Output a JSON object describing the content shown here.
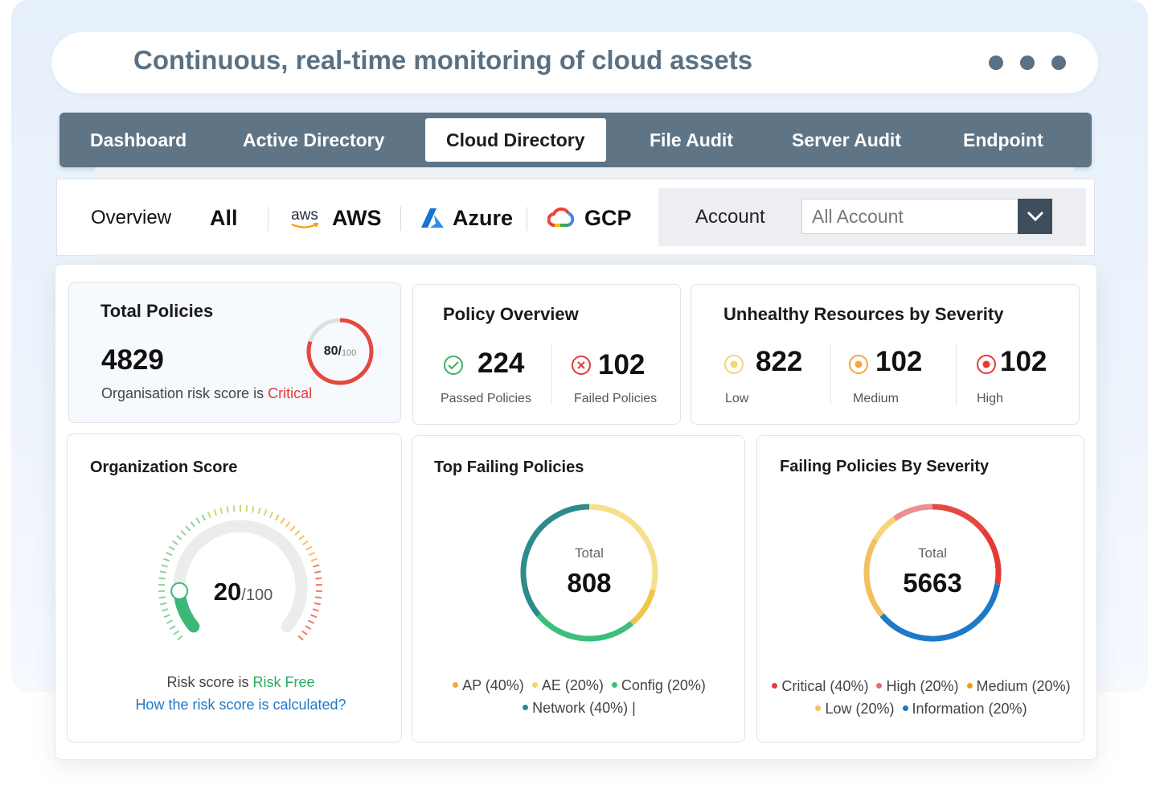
{
  "header": {
    "title": "Continuous, real-time monitoring of cloud assets"
  },
  "nav": {
    "items": [
      {
        "label": "Dashboard",
        "active": false
      },
      {
        "label": "Active Directory",
        "active": false
      },
      {
        "label": "Cloud Directory",
        "active": true
      },
      {
        "label": "File Audit",
        "active": false
      },
      {
        "label": "Server Audit",
        "active": false
      },
      {
        "label": "Endpoint",
        "active": false
      }
    ]
  },
  "subnav": {
    "overview": "Overview",
    "all": "All",
    "aws": "AWS",
    "aws_logo": "aws",
    "azure": "Azure",
    "gcp": "GCP",
    "account_label": "Account",
    "account_value": "All Account"
  },
  "total_policies": {
    "title": "Total Policies",
    "value": "4829",
    "score": "80/",
    "score_max": "100",
    "score_fraction": 0.8,
    "caption": "Organisation risk score is ",
    "status": "Critical",
    "status_color": "#e53935"
  },
  "policy_overview": {
    "title": "Policy Overview",
    "passed_value": "224",
    "passed_label": "Passed Policies",
    "failed_value": "102",
    "failed_label": "Failed Policies"
  },
  "unhealthy": {
    "title": "Unhealthy Resources by Severity",
    "items": [
      {
        "value": "822",
        "label": "Low",
        "color": "#f7d37a"
      },
      {
        "value": "102",
        "label": "Medium",
        "color": "#f3a63b"
      },
      {
        "value": "102",
        "label": "High",
        "color": "#e53935"
      }
    ]
  },
  "org_score": {
    "title": "Organization Score",
    "score": "20",
    "score_max": "/100",
    "score_fraction": 0.2,
    "caption": "Risk score is ",
    "status": "Risk Free",
    "status_color": "#27ae60",
    "link": "How the risk score is calculated?"
  },
  "top_failing": {
    "title": "Top Failing Policies",
    "total_label": "Total",
    "total_value": "808",
    "legend_line1": [
      {
        "label": "AP (40%)",
        "color": "#f3a63b"
      },
      {
        "label": "AE (20%)",
        "color": "#f5d36b"
      },
      {
        "label": "Config (20%)",
        "color": "#3cbf7d"
      }
    ],
    "legend_line2": [
      {
        "label": "Network (40%) |",
        "color": "#2e8b8b"
      }
    ]
  },
  "failing_severity": {
    "title": "Failing Policies By Severity",
    "total_label": "Total",
    "total_value": "5663",
    "legend_line1": [
      {
        "label": "Critical (40%)",
        "color": "#e53935"
      },
      {
        "label": "High (20%)",
        "color": "#ec6c6c"
      },
      {
        "label": "Medium (20%)",
        "color": "#f39c12"
      }
    ],
    "legend_line2": [
      {
        "label": "Low (20%)",
        "color": "#f7c06b"
      },
      {
        "label": "Information (20%)",
        "color": "#1f78c8"
      }
    ]
  },
  "colors": {
    "nav_bg": "#5f7586",
    "title": "#5a7184",
    "link": "#1f78c8"
  }
}
